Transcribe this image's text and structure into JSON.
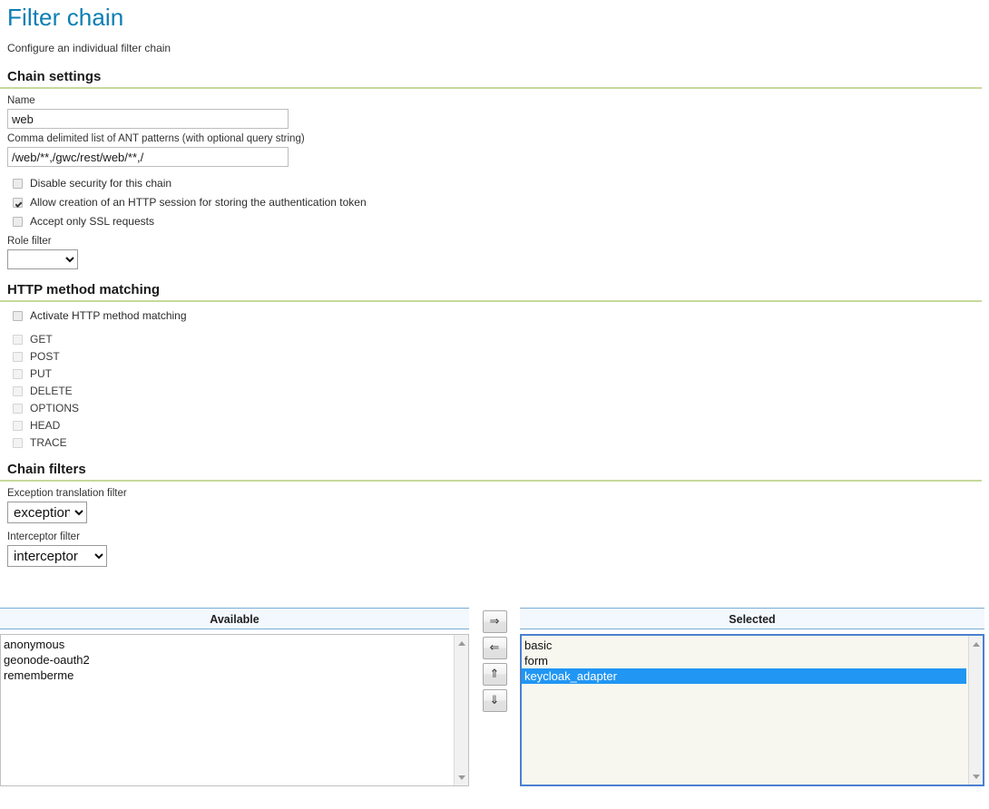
{
  "page": {
    "title": "Filter chain",
    "subtitle": "Configure an individual filter chain"
  },
  "chain_settings": {
    "heading": "Chain settings",
    "name_label": "Name",
    "name_value": "web",
    "patterns_label": "Comma delimited list of ANT patterns (with optional query string)",
    "patterns_value": "/web/**,/gwc/rest/web/**,/",
    "checkboxes": [
      {
        "label": "Disable security for this chain",
        "checked": false
      },
      {
        "label": "Allow creation of an HTTP session for storing the authentication token",
        "checked": true
      },
      {
        "label": "Accept only SSL requests",
        "checked": false
      }
    ],
    "role_filter_label": "Role filter",
    "role_filter_value": "",
    "role_filter_options": [
      ""
    ]
  },
  "http_method_matching": {
    "heading": "HTTP method matching",
    "activate_label": "Activate HTTP method matching",
    "activate_checked": false,
    "methods": [
      {
        "label": "GET",
        "checked": false
      },
      {
        "label": "POST",
        "checked": false
      },
      {
        "label": "PUT",
        "checked": false
      },
      {
        "label": "DELETE",
        "checked": false
      },
      {
        "label": "OPTIONS",
        "checked": false
      },
      {
        "label": "HEAD",
        "checked": false
      },
      {
        "label": "TRACE",
        "checked": false
      }
    ]
  },
  "chain_filters": {
    "heading": "Chain filters",
    "exception_label": "Exception translation filter",
    "exception_value": "exception",
    "exception_options": [
      "exception"
    ],
    "interceptor_label": "Interceptor filter",
    "interceptor_value": "interceptor",
    "interceptor_options": [
      "interceptor"
    ]
  },
  "palette": {
    "available_header": "Available",
    "selected_header": "Selected",
    "available_items": [
      "anonymous",
      "geonode-oauth2",
      "rememberme"
    ],
    "selected_items": [
      {
        "label": "basic",
        "selected": false
      },
      {
        "label": "form",
        "selected": false
      },
      {
        "label": "keycloak_adapter",
        "selected": true
      }
    ],
    "buttons": [
      {
        "name": "add-button",
        "glyph": "⇒"
      },
      {
        "name": "remove-button",
        "glyph": "⇐"
      },
      {
        "name": "move-up-button",
        "glyph": "⇑"
      },
      {
        "name": "move-down-button",
        "glyph": "⇓"
      }
    ]
  },
  "colors": {
    "title": "#0b7eb4",
    "rule": "#c6d99c",
    "selection": "#2196f3",
    "header_bg": "#f2f8fd",
    "header_border": "#7aadd4",
    "focus_border": "#4a80d0"
  }
}
